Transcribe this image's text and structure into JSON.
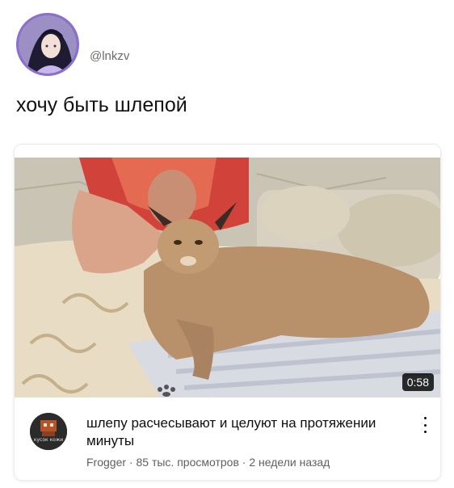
{
  "post": {
    "handle": "@lnkzv",
    "text": "хочу быть шлепой"
  },
  "video": {
    "duration": "0:58",
    "title": "шлепу расчесывают и целуют на протяжении минуты",
    "channel": "Frogger",
    "views": "85 тыс. просмотров",
    "age": "2 недели назад",
    "meta_separator": " · "
  },
  "channel_avatar": {
    "caption": "кусок кожи"
  },
  "colors": {
    "avatar_ring": "#8a6fd0",
    "duration_bg": "#000000",
    "meta_text": "#606060"
  },
  "icons": [
    "more-vert-icon"
  ]
}
